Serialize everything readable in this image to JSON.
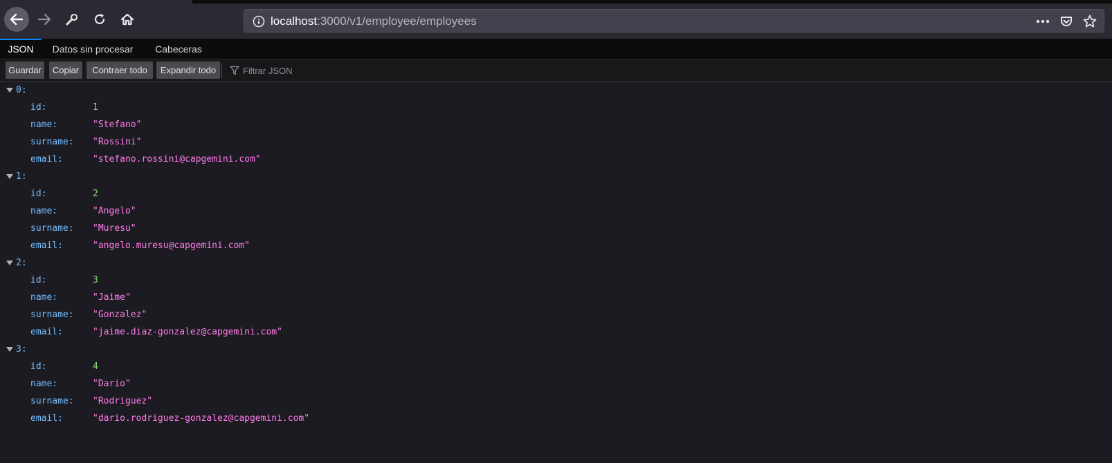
{
  "browser": {
    "url_host": "localhost",
    "url_path": ":3000/v1/employee/employees",
    "icons": {
      "back": "back-arrow-icon",
      "forward": "forward-arrow-icon",
      "tools": "wrench-icon",
      "reload": "reload-icon",
      "home": "home-icon",
      "info": "info-icon",
      "more": "more-horizontal-icon",
      "pocket": "pocket-icon",
      "bookmark": "star-icon"
    }
  },
  "tabs": [
    {
      "label": "JSON",
      "active": true
    },
    {
      "label": "Datos sin procesar",
      "active": false
    },
    {
      "label": "Cabeceras",
      "active": false
    }
  ],
  "toolbar": {
    "save_label": "Guardar",
    "copy_label": "Copiar",
    "collapse_label": "Contraer todo",
    "expand_label": "Expandir todo",
    "filter_placeholder": "Filtrar JSON"
  },
  "colors": {
    "key": "#75bfff",
    "number": "#86de74",
    "string": "#ff7de9",
    "accent": "#0a84ff"
  },
  "records": [
    {
      "index": "0:",
      "id_key": "id:",
      "id": "1",
      "name_key": "name:",
      "name": "\"Stefano\"",
      "surname_key": "surname:",
      "surname": "\"Rossini\"",
      "email_key": "email:",
      "email": "\"stefano.rossini@capgemini.com\""
    },
    {
      "index": "1:",
      "id_key": "id:",
      "id": "2",
      "name_key": "name:",
      "name": "\"Angelo\"",
      "surname_key": "surname:",
      "surname": "\"Muresu\"",
      "email_key": "email:",
      "email": "\"angelo.muresu@capgemini.com\""
    },
    {
      "index": "2:",
      "id_key": "id:",
      "id": "3",
      "name_key": "name:",
      "name": "\"Jaime\"",
      "surname_key": "surname:",
      "surname": "\"Gonzalez\"",
      "email_key": "email:",
      "email": "\"jaime.diaz-gonzalez@capgemini.com\""
    },
    {
      "index": "3:",
      "id_key": "id:",
      "id": "4",
      "name_key": "name:",
      "name": "\"Dario\"",
      "surname_key": "surname:",
      "surname": "\"Rodriguez\"",
      "email_key": "email:",
      "email": "\"dario.rodriguez-gonzalez@capgemini.com\""
    }
  ]
}
